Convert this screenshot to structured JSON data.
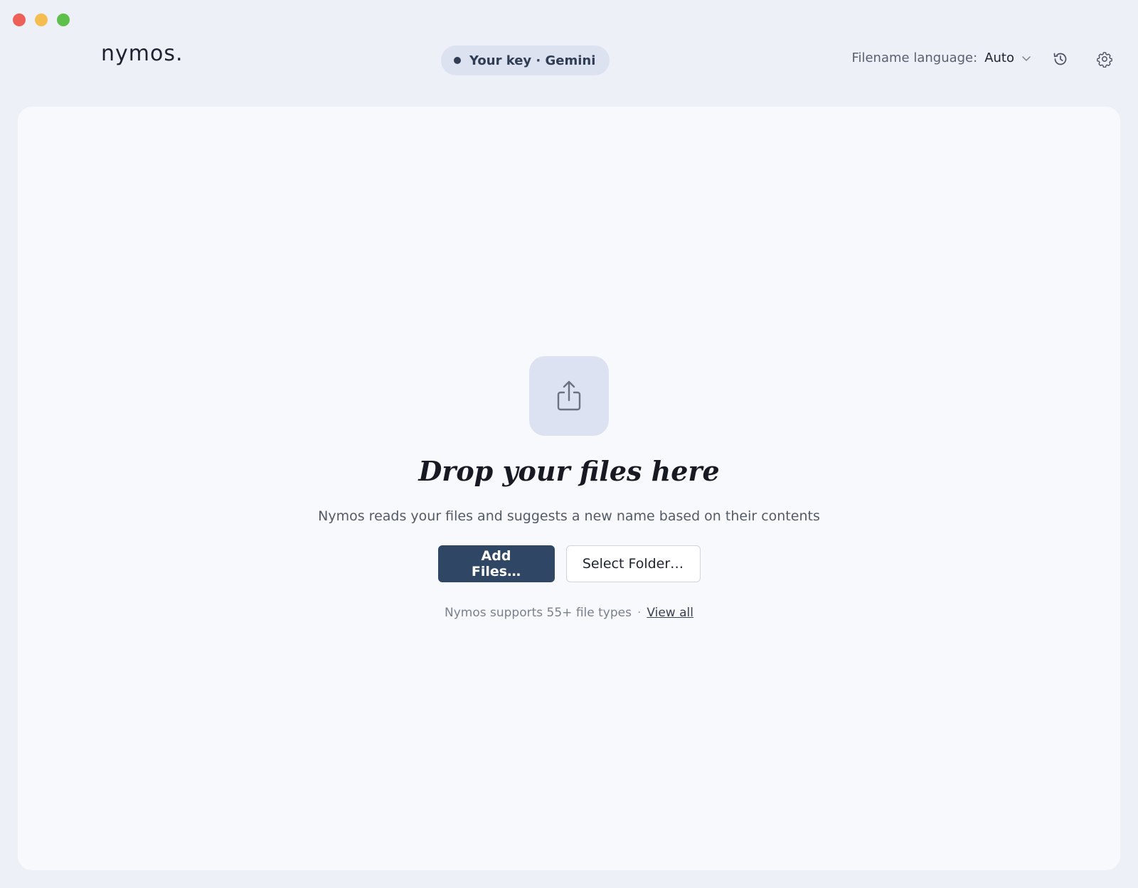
{
  "app": {
    "logo_text": "nymos."
  },
  "header": {
    "key_pill_label": "Your key · Gemini",
    "filename_language_label": "Filename language:",
    "filename_language_value": "Auto",
    "icons": {
      "history": "history-icon",
      "settings": "gear-icon",
      "language_dropdown": "chevron-down-icon"
    }
  },
  "dropzone": {
    "icon": "upload-icon",
    "title": "Drop your files here",
    "subtitle": "Nymos reads your files and suggests a new name based on their contents",
    "add_files_label": "Add Files…",
    "select_folder_label": "Select Folder…",
    "support_text": "Nymos supports 55+ file types",
    "separator": "·",
    "view_all_label": "View all"
  },
  "colors": {
    "window_bg": "#edf0f7",
    "panel_bg": "#f8f9fd",
    "primary_button": "#2f4665",
    "pill_bg": "#dde2f1",
    "traffic_close": "#ee5f57",
    "traffic_minimize": "#f5bd4f",
    "traffic_maximize": "#5ec04a"
  }
}
